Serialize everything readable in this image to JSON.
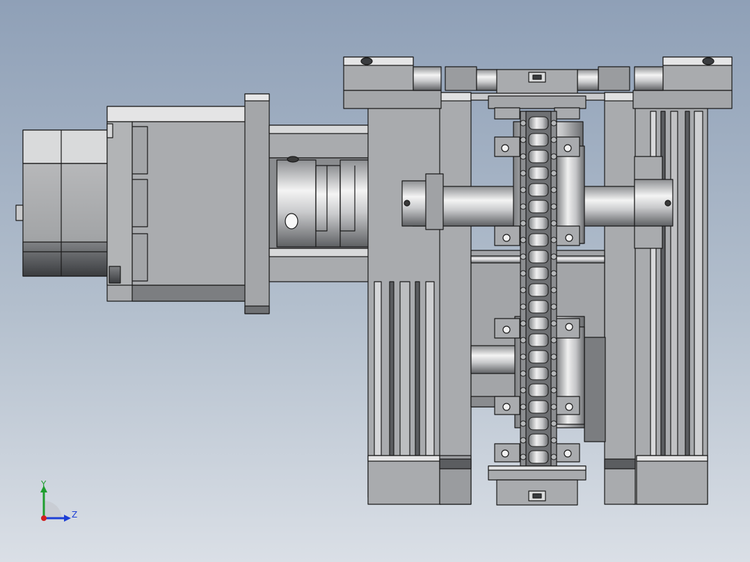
{
  "viewport": {
    "background_top": "#8fa0b7",
    "background_bottom": "#dadfe6"
  },
  "triad": {
    "y_label": "Y",
    "z_label": "Z",
    "y_color": "#1e9e2e",
    "z_color": "#1d3fd6",
    "x_color": "#d21e1e"
  },
  "model": {
    "part_fill": "#a9abae",
    "edge_color": "#1a1a1a",
    "shaft_highlight": "#f4f4f4"
  }
}
